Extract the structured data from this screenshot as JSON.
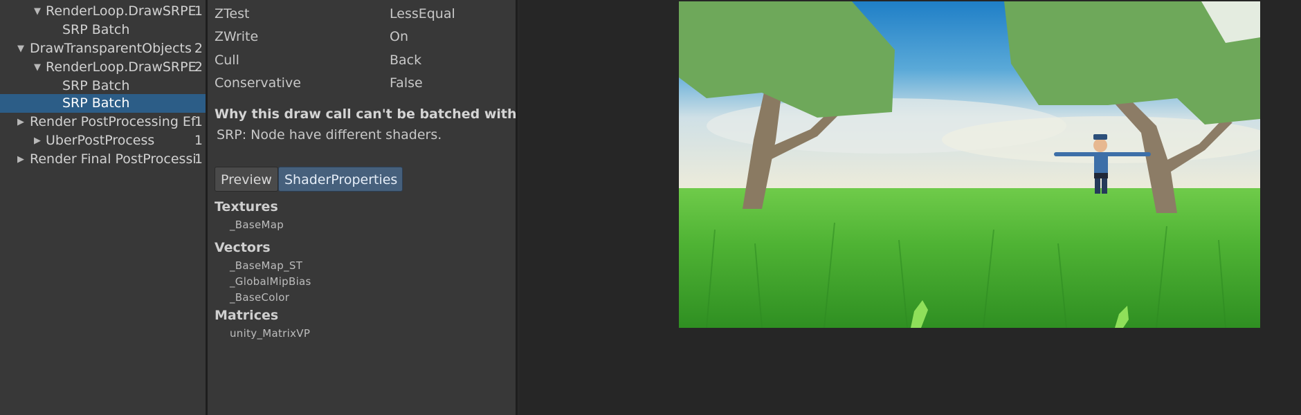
{
  "tree": {
    "rows": [
      {
        "label": "RenderLoop.DrawSRPE",
        "count": "1",
        "expanded": true
      },
      {
        "label": "SRP Batch",
        "count": ""
      },
      {
        "label": "DrawTransparentObjects",
        "count": "2",
        "expanded": true
      },
      {
        "label": "RenderLoop.DrawSRPE",
        "count": "2",
        "expanded": true
      },
      {
        "label": "SRP Batch",
        "count": ""
      },
      {
        "label": "SRP Batch",
        "count": "",
        "selected": true
      },
      {
        "label": "Render PostProcessing Ef",
        "count": "1",
        "expanded": false
      },
      {
        "label": "UberPostProcess",
        "count": "1",
        "expanded": false
      },
      {
        "label": "Render Final PostProcessi",
        "count": "1",
        "expanded": false
      }
    ]
  },
  "details": {
    "state": [
      {
        "key": "ZTest",
        "value": "LessEqual"
      },
      {
        "key": "ZWrite",
        "value": "On"
      },
      {
        "key": "Cull",
        "value": "Back"
      },
      {
        "key": "Conservative",
        "value": "False"
      }
    ],
    "batch_reason_title": "Why this draw call can't be batched with the",
    "batch_reason": "SRP: Node have different shaders.",
    "tabs": {
      "preview": "Preview",
      "shader_properties": "ShaderProperties"
    },
    "textures": {
      "title": "Textures",
      "items": [
        "_BaseMap"
      ]
    },
    "vectors": {
      "title": "Vectors",
      "items": [
        "_BaseMap_ST",
        "_GlobalMipBias",
        "_BaseColor"
      ]
    },
    "matrices": {
      "title": "Matrices",
      "items": [
        "unity_MatrixVP"
      ]
    }
  },
  "colors": {
    "selection": "#2c5d87",
    "active_tab": "#46607c",
    "panel": "#383838",
    "viewport_bg": "#262626",
    "sky": "#2f8fd0",
    "grass": "#3fa72a",
    "foliage": "#6ea85a",
    "trunk": "#8a7a62"
  },
  "icons": {
    "expanded": "triangle-down-icon",
    "collapsed": "triangle-right-icon"
  }
}
